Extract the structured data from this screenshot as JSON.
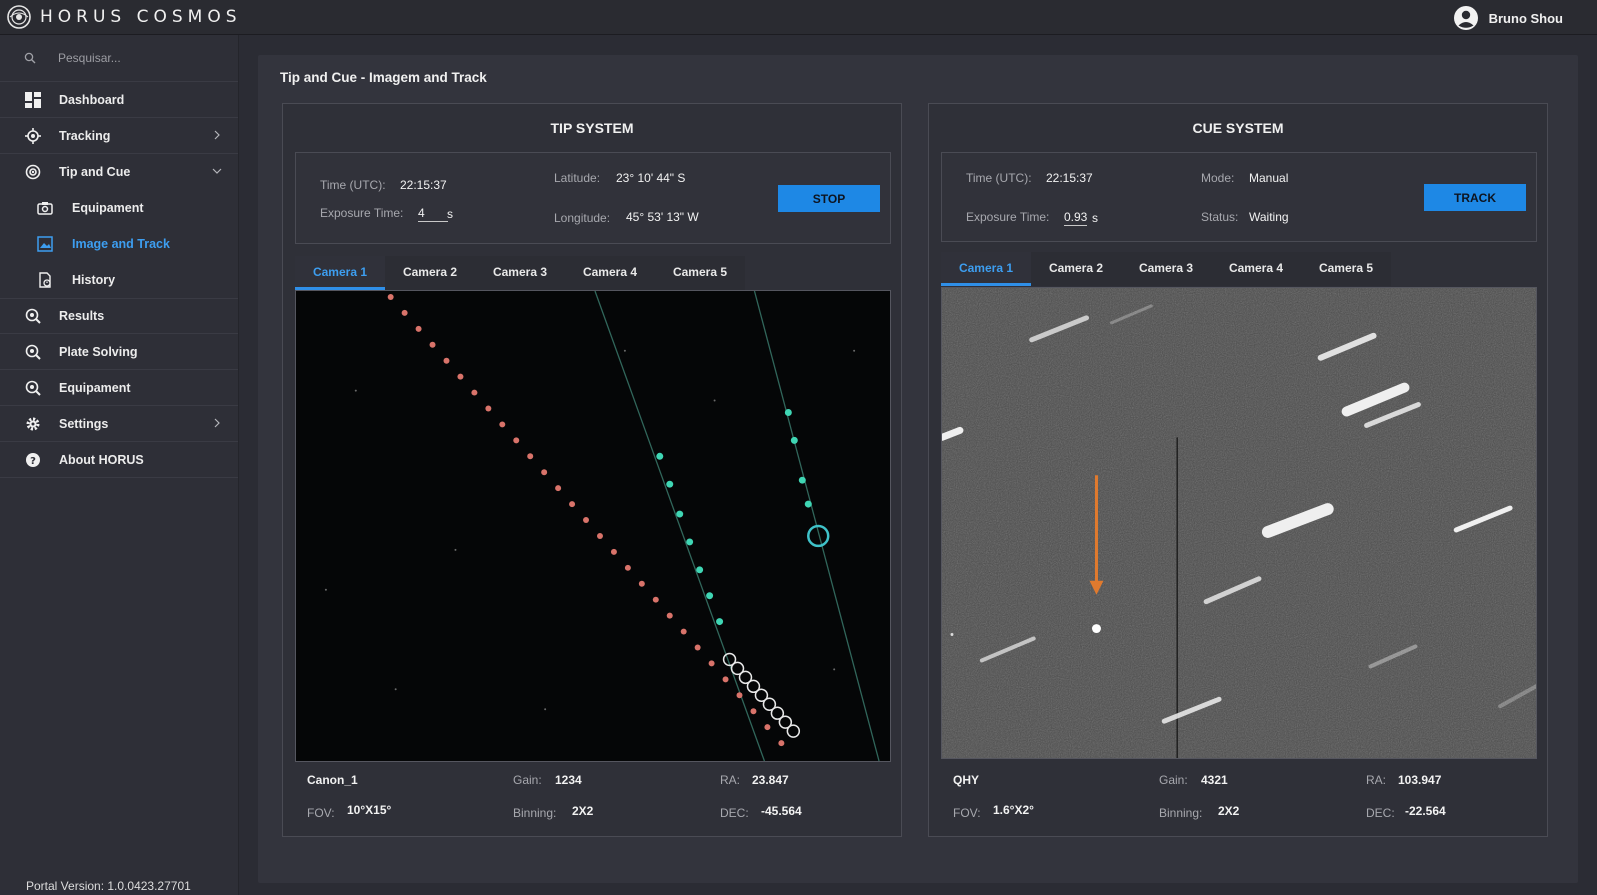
{
  "app": {
    "title": "HORUS COSMOS",
    "user": "Bruno Shou"
  },
  "search": {
    "placeholder": "Pesquisar..."
  },
  "sidebar": {
    "items": [
      {
        "label": "Dashboard",
        "icon": "dashboard-icon"
      },
      {
        "label": "Tracking",
        "icon": "tracking-icon"
      },
      {
        "label": "Tip and Cue",
        "icon": "tip-cue-icon"
      },
      {
        "label": "Equipament",
        "icon": "camera-icon"
      },
      {
        "label": "Image and Track",
        "icon": "image-icon"
      },
      {
        "label": "History",
        "icon": "history-icon"
      },
      {
        "label": "Results",
        "icon": "results-icon"
      },
      {
        "label": "Plate Solving",
        "icon": "plate-solving-icon"
      },
      {
        "label": "Equipament",
        "icon": "equipment-icon"
      },
      {
        "label": "Settings",
        "icon": "gear-icon"
      },
      {
        "label": "About HORUS",
        "icon": "help-icon"
      }
    ],
    "version": "Portal Version: 1.0.0423.27701"
  },
  "page": {
    "title": "Tip and Cue - Imagem and Track"
  },
  "tip": {
    "title": "TIP SYSTEM",
    "time_label": "Time (UTC):",
    "time": "22:15:37",
    "exposure_label": "Exposure Time:",
    "exposure": "4",
    "exposure_unit": "s",
    "lat_label": "Latitude:",
    "lat": "23° 10' 44\" S",
    "lon_label": "Longitude:",
    "lon": "45° 53' 13\" W",
    "button": "STOP",
    "tabs": [
      "Camera 1",
      "Camera 2",
      "Camera 3",
      "Camera 4",
      "Camera 5"
    ],
    "camera": "Canon_1",
    "gain_label": "Gain:",
    "gain": "1234",
    "ra_label": "RA:",
    "ra": "23.847",
    "fov_label": "FOV:",
    "fov": "10°X15°",
    "binning_label": "Binning:",
    "binning": "2X2",
    "dec_label": "DEC:",
    "dec": "-45.564"
  },
  "cue": {
    "title": "CUE SYSTEM",
    "time_label": "Time (UTC):",
    "time": "22:15:37",
    "exposure_label": "Exposure Time:",
    "exposure": "0.93",
    "exposure_unit": "s",
    "mode_label": "Mode:",
    "mode": "Manual",
    "status_label": "Status:",
    "status": "Waiting",
    "button": "TRACK",
    "tabs": [
      "Camera 1",
      "Camera 2",
      "Camera 3",
      "Camera 4",
      "Camera 5"
    ],
    "camera": "QHY",
    "gain_label": "Gain:",
    "gain": "4321",
    "ra_label": "RA:",
    "ra": "103.947",
    "fov_label": "FOV:",
    "fov": "1.6°X2°",
    "binning_label": "Binning:",
    "binning": "2X2",
    "dec_label": "DEC:",
    "dec": "-22.564"
  },
  "colors": {
    "accent": "#1e88e5",
    "active_text": "#3d9ef0",
    "track_red": "#d9736a",
    "track_cyan": "#3fd6b4",
    "arrow": "#e07a2e"
  }
}
